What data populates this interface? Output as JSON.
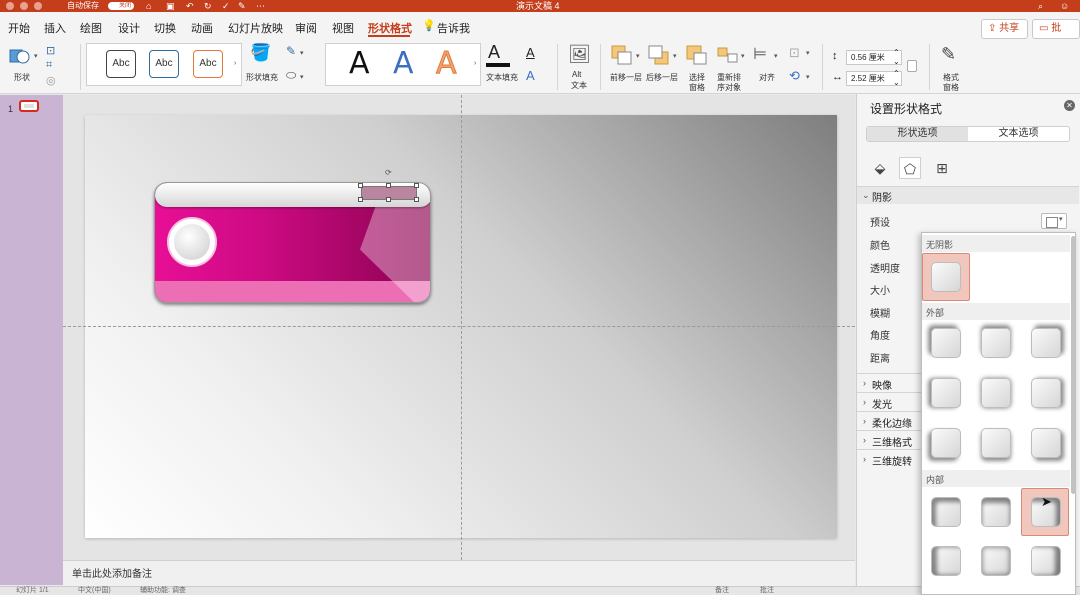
{
  "titlebar": {
    "autosave_label": "自动保存",
    "autosave_state": "关闭",
    "doc_title": "演示文稿 4"
  },
  "menu": {
    "tabs": [
      "开始",
      "插入",
      "绘图",
      "设计",
      "切换",
      "动画",
      "幻灯片放映",
      "审阅",
      "视图",
      "形状格式"
    ],
    "tell_me": "告诉我",
    "share": "共享",
    "comment": "批注",
    "accent_color": "#c43e1c"
  },
  "ribbon": {
    "shape": "形状",
    "style_samples": [
      "Abc",
      "Abc",
      "Abc"
    ],
    "shape_fill": "形状填充",
    "wordart_samples": [
      "A",
      "A",
      "A"
    ],
    "text_fill": "文本填充",
    "alt_text_line1": "Alt",
    "alt_text_line2": "文本",
    "bring_forward": "前移一层",
    "send_backward": "后移一层",
    "selection_pane_line1": "选择",
    "selection_pane_line2": "窗格",
    "reorder_line1": "重新排",
    "reorder_line2": "序对象",
    "align": "对齐",
    "height_value": "0.56 厘米",
    "width_value": "2.52 厘米",
    "format_pane_line1": "格式",
    "format_pane_line2": "窗格"
  },
  "slides": {
    "current_number": "1"
  },
  "notes": {
    "placeholder": "单击此处添加备注"
  },
  "statusbar": {
    "slide_info": "幻灯片 1/1",
    "language": "中文(中国)",
    "accessibility": "辅助功能: 调查",
    "notes_btn": "备注",
    "comments_btn": "批注"
  },
  "panel": {
    "title": "设置形状格式",
    "tab_shape": "形状选项",
    "tab_text": "文本选项",
    "section_shadow": "阴影",
    "props": [
      "预设",
      "颜色",
      "透明度",
      "大小",
      "模糊",
      "角度",
      "距离"
    ],
    "collapsed_sections": [
      "映像",
      "发光",
      "柔化边缘",
      "三维格式",
      "三维旋转"
    ]
  },
  "shadow_presets": {
    "no_shadow": "无阴影",
    "outer": "外部",
    "inner": "内部"
  }
}
